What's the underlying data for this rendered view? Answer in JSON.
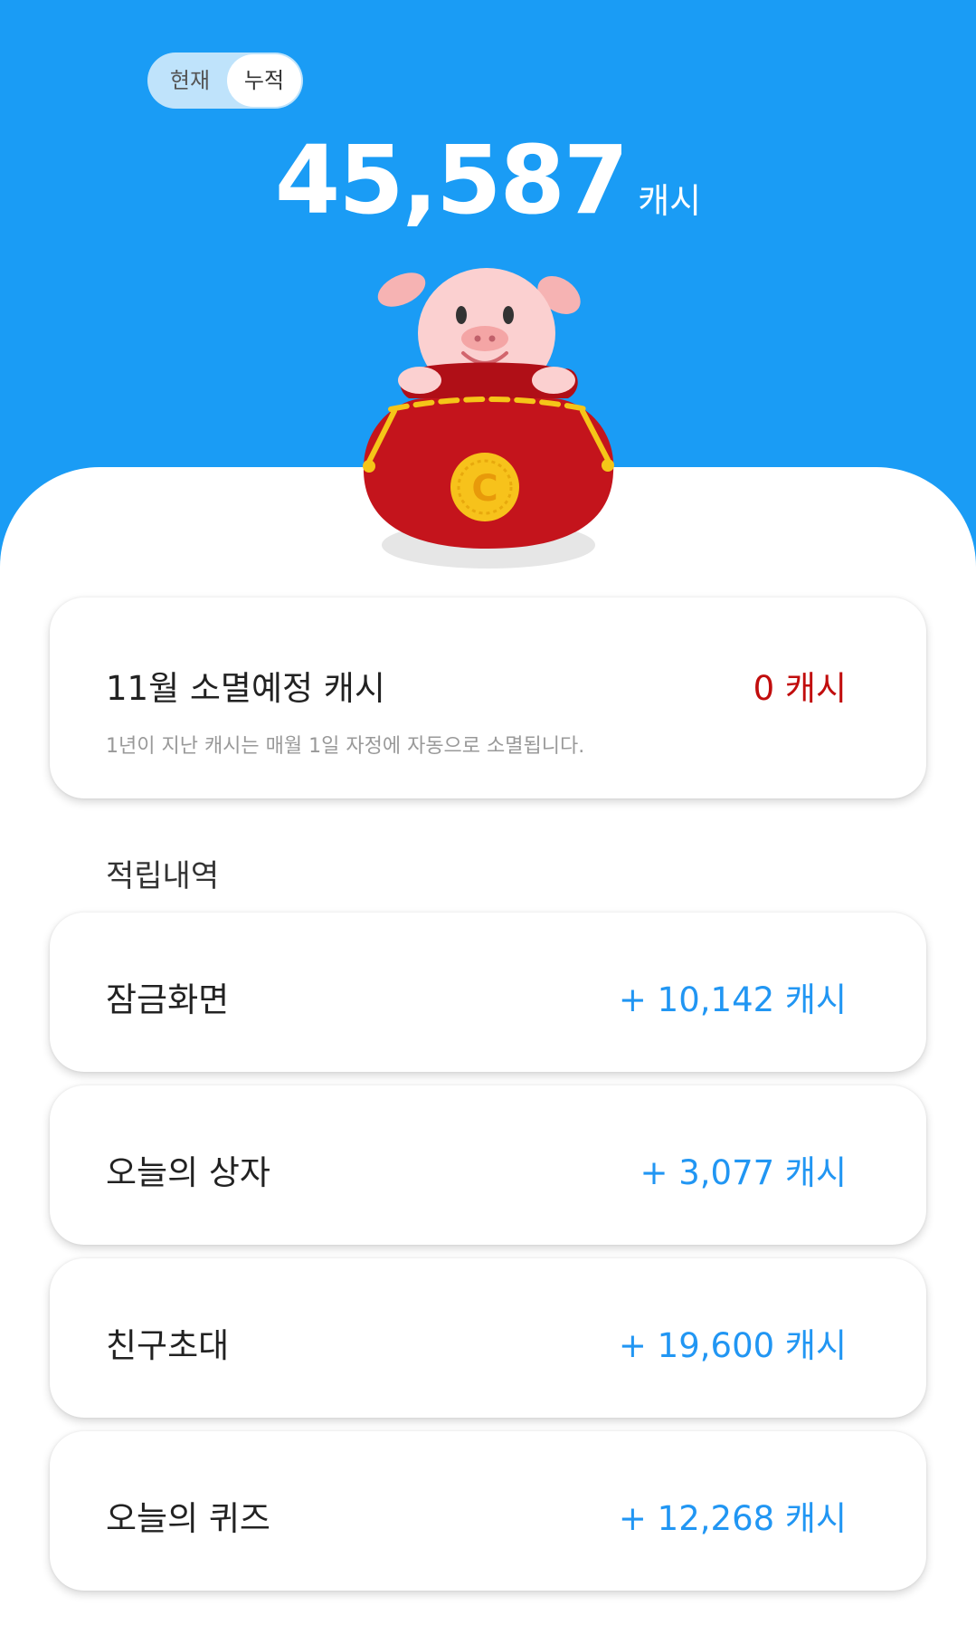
{
  "header": {
    "toggle": {
      "current": "현재",
      "total": "누적"
    },
    "balance": "45,587",
    "balance_unit": "캐시"
  },
  "expiry_card": {
    "title": "11월 소멸예정 캐시",
    "amount": "0 캐시",
    "note": "1년이 지난 캐시는 매월 1일 자정에 자동으로 소멸됩니다."
  },
  "history": {
    "title": "적립내역",
    "items": [
      {
        "label": "잠금화면",
        "amount": "+ 10,142 캐시"
      },
      {
        "label": "오늘의 상자",
        "amount": "+ 3,077 캐시"
      },
      {
        "label": "친구초대",
        "amount": "+ 19,600 캐시"
      },
      {
        "label": "오늘의 퀴즈",
        "amount": "+ 12,268 캐시"
      }
    ]
  },
  "colors": {
    "hero_blue": "#1a9cf5",
    "accent_blue": "#2196f3",
    "expire_red": "#c10d0d"
  },
  "mascot": {
    "icon": "pig-in-money-bag-icon",
    "coin_letter": "C"
  }
}
